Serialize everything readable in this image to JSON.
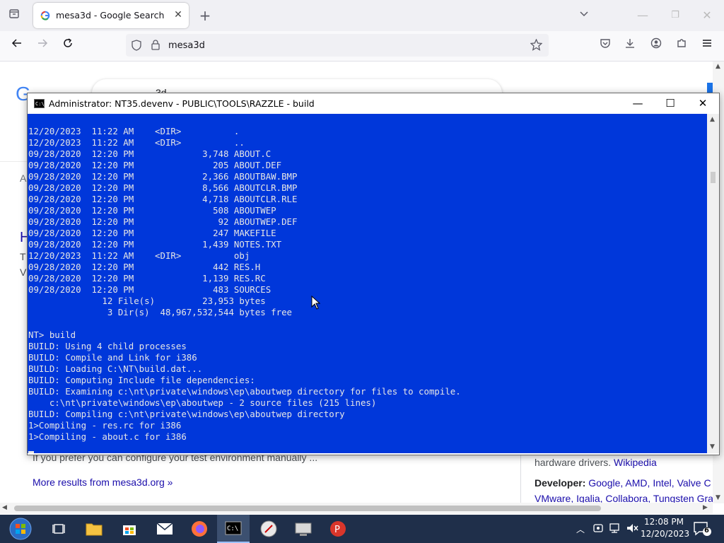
{
  "browser": {
    "tab_title": "mesa3d - Google Search",
    "new_tab_symbol": "+",
    "address": "mesa3d"
  },
  "page": {
    "partial_search": "3d",
    "left_fragments": [
      "A",
      "H",
      "T",
      "V"
    ],
    "text_manual": "If you prefer you can configure your test environment manually ...",
    "more_results_link": "More results from mesa3d.org »",
    "knowledge": {
      "line1_text": "hardware drivers.",
      "line1_link": "Wikipedia",
      "developer_label": "Developer:",
      "developer_links": [
        "Google",
        "AMD",
        "Intel",
        "Valve C"
      ],
      "developer_links_2": [
        "VMware",
        "Igalia",
        "Collabora",
        "Tungsten Gra"
      ]
    }
  },
  "console_window": {
    "title": "Administrator:  NT35.devenv  - PUBLIC\\TOOLS\\RAZZLE - build",
    "lines": [
      "12/20/2023  11:22 AM    <DIR>          .",
      "12/20/2023  11:22 AM    <DIR>          ..",
      "09/28/2020  12:20 PM             3,748 ABOUT.C",
      "09/28/2020  12:20 PM               205 ABOUT.DEF",
      "09/28/2020  12:20 PM             2,366 ABOUTBAW.BMP",
      "09/28/2020  12:20 PM             8,566 ABOUTCLR.BMP",
      "09/28/2020  12:20 PM             4,718 ABOUTCLR.RLE",
      "09/28/2020  12:20 PM               508 ABOUTWEP",
      "09/28/2020  12:20 PM                92 ABOUTWEP.DEF",
      "09/28/2020  12:20 PM               247 MAKEFILE",
      "09/28/2020  12:20 PM             1,439 NOTES.TXT",
      "12/20/2023  11:22 AM    <DIR>          obj",
      "09/28/2020  12:20 PM               442 RES.H",
      "09/28/2020  12:20 PM             1,139 RES.RC",
      "09/28/2020  12:20 PM               483 SOURCES",
      "              12 File(s)         23,953 bytes",
      "               3 Dir(s)  48,967,532,544 bytes free",
      "",
      "NT> build",
      "BUILD: Using 4 child processes",
      "BUILD: Compile and Link for i386",
      "BUILD: Loading C:\\NT\\build.dat...",
      "BUILD: Computing Include file dependencies:",
      "BUILD: Examining c:\\nt\\private\\windows\\ep\\aboutwep directory for files to compile.",
      "    c:\\nt\\private\\windows\\ep\\aboutwep - 2 source files (215 lines)",
      "BUILD: Compiling c:\\nt\\private\\windows\\ep\\aboutwep directory",
      "1>Compiling - res.rc for i386",
      "1>Compiling - about.c for i386"
    ]
  },
  "taskbar": {
    "time": "12:08 PM",
    "date": "12/20/2023",
    "notification_count": "6"
  },
  "colors": {
    "console_bg": "#0037da",
    "console_fg": "#e6e6e6",
    "taskbar_bg": "#1f2f4a",
    "link": "#1a0dab"
  }
}
